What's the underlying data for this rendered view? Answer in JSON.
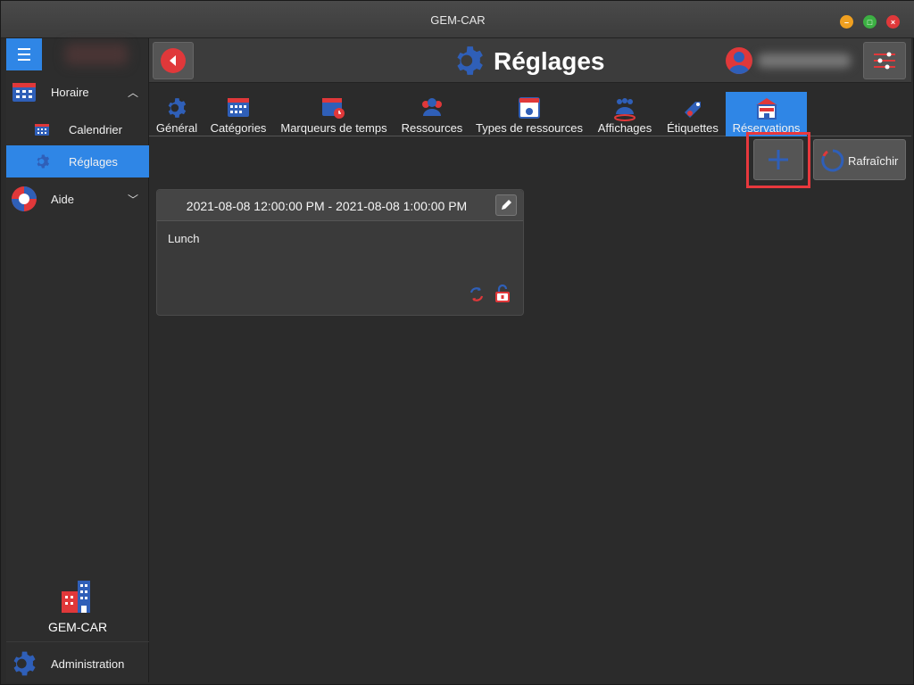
{
  "window": {
    "title": "GEM-CAR"
  },
  "sidebar": {
    "sections": [
      {
        "label": "Horaire",
        "expanded": true
      },
      {
        "label": "Aide",
        "expanded": false
      }
    ],
    "items": [
      {
        "label": "Calendrier"
      },
      {
        "label": "Réglages",
        "active": true
      }
    ],
    "brand_name": "GEM-CAR",
    "admin_label": "Administration"
  },
  "header": {
    "title": "Réglages"
  },
  "tabs": [
    {
      "label": "Général",
      "icon": "gear-icon"
    },
    {
      "label": "Catégories",
      "icon": "calendar-grid-icon"
    },
    {
      "label": "Marqueurs de temps",
      "icon": "calendar-clock-icon"
    },
    {
      "label": "Ressources",
      "icon": "group-icon"
    },
    {
      "label": "Types de ressources",
      "icon": "resource-card-icon"
    },
    {
      "label": "Affichages",
      "icon": "people-display-icon"
    },
    {
      "label": "Étiquettes",
      "icon": "tag-icon"
    },
    {
      "label": "Réservations",
      "icon": "reservation-building-icon",
      "active": true
    }
  ],
  "toolbar": {
    "refresh_label": "Rafraîchir"
  },
  "reservation": {
    "dates": "2021-08-08 12:00:00 PM - 2021-08-08 1:00:00 PM",
    "description": "Lunch"
  },
  "colors": {
    "accent": "#2f86e6",
    "icon_blue": "#2f5fb8",
    "icon_red": "#e0383a",
    "highlight": "#e8383d"
  }
}
